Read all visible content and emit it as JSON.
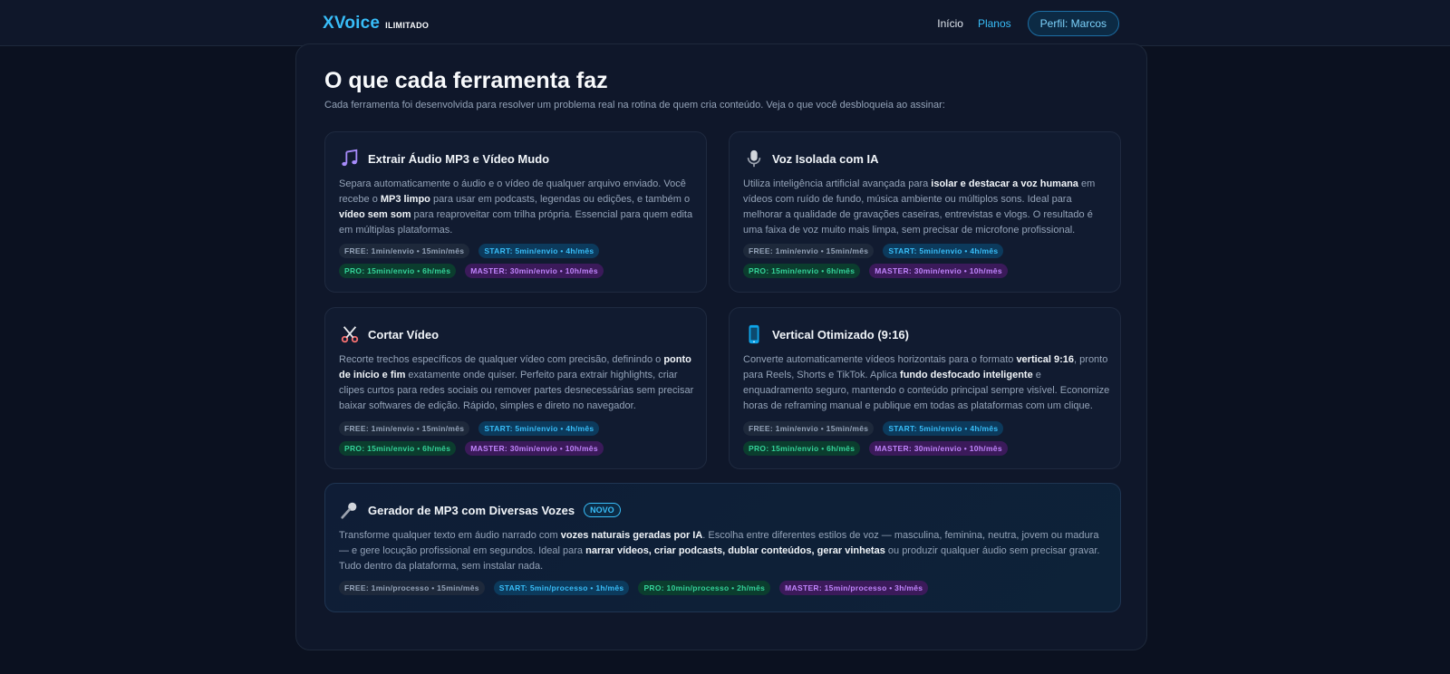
{
  "header": {
    "brand": "XVoice",
    "brand_badge": "ILIMITADO",
    "nav": {
      "home": "Início",
      "plans": "Planos"
    },
    "profile_button": "Perfil: Marcos"
  },
  "section": {
    "title": "O que cada ferramenta faz",
    "subtitle": "Cada ferramenta foi desenvolvida para resolver um problema real na rotina de quem cria conteúdo. Veja o que você desbloqueia ao assinar:"
  },
  "colors": {
    "accent": "#38bdf8",
    "background": "#0b1120",
    "free": "#94a3b8",
    "start": "#38bdf8",
    "pro": "#34d399",
    "master": "#c084fc"
  },
  "tools": [
    {
      "icon": "music-notes-icon",
      "title": "Extrair Áudio MP3 e Vídeo Mudo",
      "desc": [
        {
          "t": "Separa automaticamente o áudio e o vídeo de qualquer arquivo enviado. Você recebe o "
        },
        {
          "t": "MP3 limpo",
          "b": true
        },
        {
          "t": " para usar em podcasts, legendas ou edições, e também o "
        },
        {
          "t": "vídeo sem som",
          "b": true
        },
        {
          "t": " para reaproveitar com trilha própria. Essencial para quem edita em múltiplas plataformas."
        }
      ],
      "tags": {
        "free": "FREE: 1min/envio • 15min/mês",
        "start": "START: 5min/envio • 4h/mês",
        "pro": "PRO: 15min/envio • 6h/mês",
        "master": "MASTER: 30min/envio • 10h/mês"
      }
    },
    {
      "icon": "microphone-icon",
      "title": "Voz Isolada com IA",
      "desc": [
        {
          "t": "Utiliza inteligência artificial avançada para "
        },
        {
          "t": "isolar e destacar a voz humana",
          "b": true
        },
        {
          "t": " em vídeos com ruído de fundo, música ambiente ou múltiplos sons. Ideal para melhorar a qualidade de gravações caseiras, entrevistas e vlogs. O resultado é uma faixa de voz muito mais limpa, sem precisar de microfone profissional."
        }
      ],
      "tags": {
        "free": "FREE: 1min/envio • 15min/mês",
        "start": "START: 5min/envio • 4h/mês",
        "pro": "PRO: 15min/envio • 6h/mês",
        "master": "MASTER: 30min/envio • 10h/mês"
      }
    },
    {
      "icon": "scissors-icon",
      "title": "Cortar Vídeo",
      "desc": [
        {
          "t": "Recorte trechos específicos de qualquer vídeo com precisão, definindo o "
        },
        {
          "t": "ponto de início e fim",
          "b": true
        },
        {
          "t": " exatamente onde quiser. Perfeito para extrair highlights, criar clipes curtos para redes sociais ou remover partes desnecessárias sem precisar baixar softwares de edição. Rápido, simples e direto no navegador."
        }
      ],
      "tags": {
        "free": "FREE: 1min/envio • 15min/mês",
        "start": "START: 5min/envio • 4h/mês",
        "pro": "PRO: 15min/envio • 6h/mês",
        "master": "MASTER: 30min/envio • 10h/mês"
      }
    },
    {
      "icon": "mobile-phone-icon",
      "title": "Vertical Otimizado (9:16)",
      "desc": [
        {
          "t": "Converte automaticamente vídeos horizontais para o formato "
        },
        {
          "t": "vertical 9:16",
          "b": true
        },
        {
          "t": ", pronto para Reels, Shorts e TikTok. Aplica "
        },
        {
          "t": "fundo desfocado inteligente",
          "b": true
        },
        {
          "t": " e enquadramento seguro, mantendo o conteúdo principal sempre visível. Economize horas de reframing manual e publique em todas as plataformas com um clique."
        }
      ],
      "tags": {
        "free": "FREE: 1min/envio • 15min/mês",
        "start": "START: 5min/envio • 4h/mês",
        "pro": "PRO: 15min/envio • 6h/mês",
        "master": "MASTER: 30min/envio • 10h/mês"
      }
    },
    {
      "icon": "microphone-icon",
      "title": "Gerador de MP3 com Diversas Vozes",
      "badge": "NOVO",
      "desc": [
        {
          "t": "Transforme qualquer texto em áudio narrado com "
        },
        {
          "t": "vozes naturais geradas por IA",
          "b": true
        },
        {
          "t": ". Escolha entre diferentes estilos de voz — masculina, feminina, neutra, jovem ou madura — e gere locução profissional em segundos. Ideal para "
        },
        {
          "t": "narrar vídeos, criar podcasts, dublar conteúdos, gerar vinhetas",
          "b": true
        },
        {
          "t": " ou produzir qualquer áudio sem precisar gravar. Tudo dentro da plataforma, sem instalar nada."
        }
      ],
      "tags": {
        "free": "FREE: 1min/processo • 15min/mês",
        "start": "START: 5min/processo • 1h/mês",
        "pro": "PRO: 10min/processo • 2h/mês",
        "master": "MASTER: 15min/processo • 3h/mês"
      }
    }
  ]
}
